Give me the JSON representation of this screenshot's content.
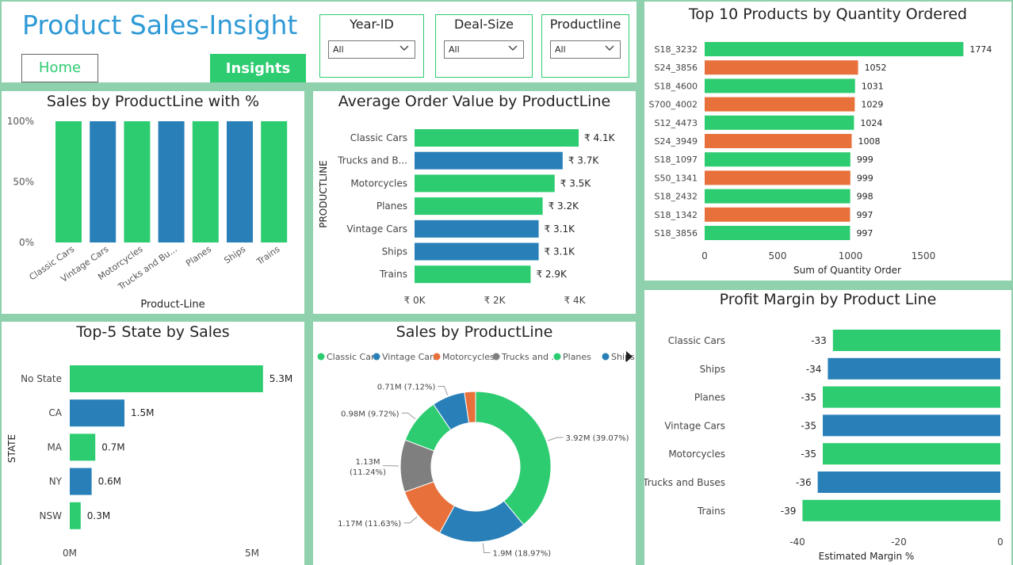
{
  "header": {
    "title": "Product Sales-Insight",
    "home_label": "Home",
    "insights_label": "Insights"
  },
  "slicers": [
    {
      "title": "Year-ID",
      "value": "All"
    },
    {
      "title": "Deal-Size",
      "value": "All"
    },
    {
      "title": "Productline",
      "value": "All"
    }
  ],
  "colors": {
    "green": "#2ecc71",
    "blue": "#2980b9",
    "orange": "#e8703a",
    "gray": "#7f7f7f",
    "title": "#2e9ad6",
    "background": "#8fd0ad"
  },
  "chart_data": [
    {
      "id": "sales_pct",
      "type": "bar",
      "title": "Sales by ProductLine with %",
      "xlabel": "Product-Line",
      "categories": [
        "Classic Cars",
        "Vintage Cars",
        "Motorcycles",
        "Trucks and Bu...",
        "Planes",
        "Ships",
        "Trains"
      ],
      "values": [
        100,
        100,
        100,
        100,
        100,
        100,
        100
      ],
      "colors": [
        "green",
        "blue",
        "green",
        "blue",
        "green",
        "blue",
        "green"
      ],
      "yticks": [
        "0%",
        "50%",
        "100%"
      ],
      "ylim": [
        0,
        100
      ]
    },
    {
      "id": "aov",
      "type": "bar",
      "orientation": "horizontal",
      "title": "Average Order Value by ProductLine",
      "ylabel": "PRODUCTLINE",
      "categories": [
        "Classic Cars",
        "Trucks and B...",
        "Motorcycles",
        "Planes",
        "Vintage Cars",
        "Ships",
        "Trains"
      ],
      "values": [
        4100,
        3700,
        3500,
        3200,
        3100,
        3100,
        2900
      ],
      "labels": [
        "₹ 4.1K",
        "₹ 3.7K",
        "₹ 3.5K",
        "₹ 3.2K",
        "₹ 3.1K",
        "₹ 3.1K",
        "₹ 2.9K"
      ],
      "colors": [
        "green",
        "blue",
        "green",
        "green",
        "blue",
        "blue",
        "green"
      ],
      "xticks": [
        "₹ 0K",
        "₹ 2K",
        "₹ 4K"
      ],
      "xlim": [
        0,
        4000
      ]
    },
    {
      "id": "top10",
      "type": "bar",
      "orientation": "horizontal",
      "title": "Top 10 Products by Quantity Ordered",
      "xlabel": "Sum of Quantity Order",
      "categories": [
        "S18_3232",
        "S24_3856",
        "S18_4600",
        "S700_4002",
        "S12_4473",
        "S24_3949",
        "S18_1097",
        "S50_1341",
        "S18_2432",
        "S18_1342",
        "S18_3856"
      ],
      "values": [
        1774,
        1052,
        1031,
        1029,
        1024,
        1008,
        999,
        999,
        998,
        997,
        997
      ],
      "colors": [
        "green",
        "orange",
        "green",
        "orange",
        "green",
        "orange",
        "green",
        "orange",
        "green",
        "orange",
        "green"
      ],
      "xticks": [
        "0",
        "500",
        "1000",
        "1500"
      ],
      "xlim": [
        0,
        1500
      ]
    },
    {
      "id": "top5_state",
      "type": "bar",
      "orientation": "horizontal",
      "title": "Top-5 State by Sales",
      "ylabel": "STATE",
      "categories": [
        "No State",
        "CA",
        "MA",
        "NY",
        "NSW"
      ],
      "values": [
        5.3,
        1.5,
        0.7,
        0.6,
        0.3
      ],
      "labels": [
        "5.3M",
        "1.5M",
        "0.7M",
        "0.6M",
        "0.3M"
      ],
      "colors": [
        "green",
        "blue",
        "green",
        "blue",
        "green"
      ],
      "xticks": [
        "0M",
        "5M"
      ],
      "xlim": [
        0,
        5
      ]
    },
    {
      "id": "donut",
      "type": "pie",
      "title": "Sales by ProductLine",
      "legend": [
        "Classic Cars",
        "Vintage Cars",
        "Motorcycles",
        "Trucks and ...",
        "Planes",
        "Ships"
      ],
      "legend_colors": [
        "green",
        "blue",
        "orange",
        "gray",
        "green",
        "blue"
      ],
      "slices": [
        {
          "value": 3.92,
          "label": "3.92M (39.07%)",
          "color": "green"
        },
        {
          "value": 1.9,
          "label": "1.9M (18.97%)",
          "color": "blue"
        },
        {
          "value": 1.17,
          "label": "1.17M (11.63%)",
          "color": "orange"
        },
        {
          "value": 1.13,
          "label": "1.13M",
          "label2": "(11.24%)",
          "color": "gray"
        },
        {
          "value": 0.98,
          "label": "0.98M (9.72%)",
          "color": "green"
        },
        {
          "value": 0.71,
          "label": "0.71M (7.12%)",
          "color": "blue"
        },
        {
          "value": 0.24,
          "label": "",
          "color": "orange"
        }
      ]
    },
    {
      "id": "profit",
      "type": "bar",
      "orientation": "horizontal",
      "title": "Profit Margin by Product Line",
      "xlabel": "Estimated Margin %",
      "categories": [
        "Classic Cars",
        "Ships",
        "Planes",
        "Vintage Cars",
        "Motorcycles",
        "Trucks and Buses",
        "Trains"
      ],
      "values": [
        -33,
        -34,
        -35,
        -35,
        -35,
        -36,
        -39
      ],
      "colors": [
        "green",
        "blue",
        "green",
        "blue",
        "green",
        "blue",
        "green"
      ],
      "xticks": [
        "-40",
        "-20",
        "0"
      ],
      "xlim": [
        -40,
        0
      ]
    }
  ]
}
